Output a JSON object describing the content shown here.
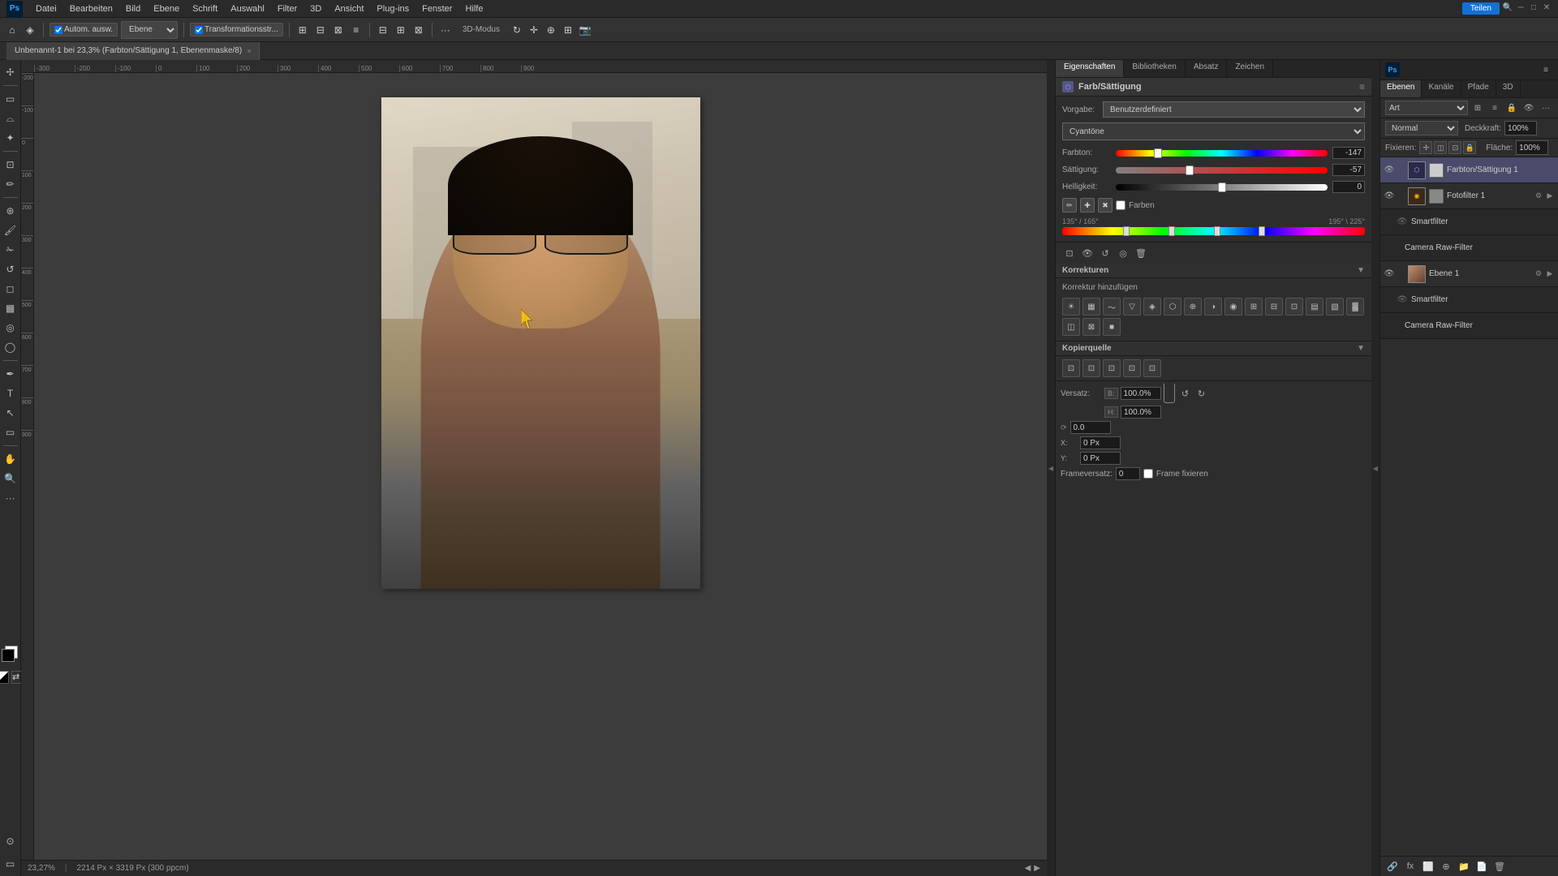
{
  "menubar": {
    "app_name": "Ps",
    "items": [
      "Datei",
      "Bearbeiten",
      "Bild",
      "Ebene",
      "Schrift",
      "Auswahl",
      "Filter",
      "3D",
      "Ansicht",
      "Plug-ins",
      "Fenster",
      "Hilfe"
    ]
  },
  "toolbar": {
    "home_icon": "⌂",
    "tool_icon": "◈",
    "autom_label": "Autom. ausw.",
    "ebene_label": "Ebene",
    "transformationsstr_label": "Transformationsstr...",
    "share_btn": "Teilen",
    "search_icon": "🔍",
    "extra_dots": "..."
  },
  "tab": {
    "title": "Unbenannt-1 bei 23,3% (Farbton/Sättigung 1, Ebenenmaske/8)",
    "close": "×"
  },
  "canvas": {
    "zoom": "23,27%",
    "dimensions": "2214 Px × 3319 Px (300 ppcm)"
  },
  "properties": {
    "panel_title": "Farb/Sättigung",
    "tabs": [
      "Eigenschaften",
      "Bibliotheken",
      "Absatz",
      "Zeichen"
    ],
    "vorgabe_label": "Vorgabe:",
    "vorgabe_value": "Benutzerdefiniert",
    "channel": "Cyantöne",
    "farbton_label": "Farbton:",
    "farbton_value": "-147",
    "sattigung_label": "Sättigung:",
    "sattigung_value": "-57",
    "helligkeit_label": "Helligkeit:",
    "helligkeit_value": "0",
    "farben_label": "Farben",
    "range_start": "135° / 165°",
    "range_end": "195° \\ 225°"
  },
  "korrekturen": {
    "title": "Korrekturen",
    "add_label": "Korrektur hinzufügen"
  },
  "kopierquelle": {
    "title": "Kopierquelle",
    "versatz_label": "Versatz:",
    "b_label": "B:",
    "b_value": "100.0%",
    "h_label": "H:",
    "h_value": "100.0%",
    "winkel_label": "0.0",
    "x_label": "X:",
    "x_value": "0 Px",
    "y_label": "Y:",
    "y_value": "0 Px",
    "frameversatz_label": "Frameversatz:",
    "frameversatz_value": "0",
    "frame_fixieren_label": "Frame fixieren"
  },
  "layers": {
    "tabs": [
      "Ebenen",
      "Kanäle",
      "Pfade",
      "3D"
    ],
    "blend_mode": "Normal",
    "deckkraft_label": "Deckkraft:",
    "deckkraft_value": "100%",
    "flache_label": "Fläche:",
    "flache_value": "100%",
    "fixieren_label": "Fixieren:",
    "items": [
      {
        "name": "Farbton/Sättigung 1",
        "type": "adjustment",
        "visible": true,
        "active": true
      },
      {
        "name": "Fotofilter 1",
        "type": "adjustment",
        "visible": true,
        "sublayers": [
          {
            "name": "Smartfilter",
            "type": "smartfilter"
          },
          {
            "name": "Camera Raw-Filter",
            "type": "filter"
          }
        ]
      },
      {
        "name": "Ebene 1",
        "type": "layer",
        "visible": true,
        "sublayers": [
          {
            "name": "Smartfilter",
            "type": "smartfilter"
          },
          {
            "name": "Camera Raw-Filter",
            "type": "filter"
          }
        ]
      }
    ]
  }
}
